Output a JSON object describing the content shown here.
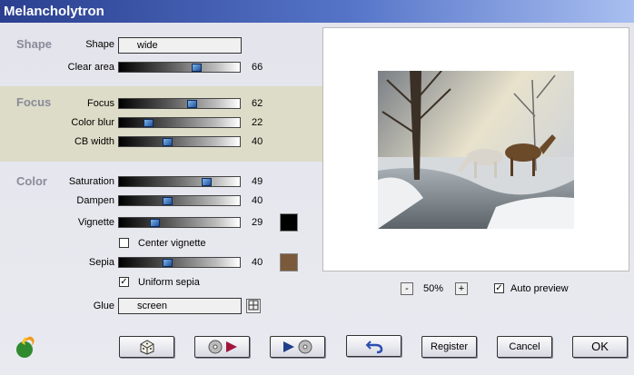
{
  "window": {
    "title": "Melancholytron"
  },
  "sections": {
    "shape": "Shape",
    "focus": "Focus",
    "color": "Color"
  },
  "shape": {
    "label": "Shape",
    "value": "wide"
  },
  "sliders": {
    "clear_area": {
      "label": "Clear area",
      "value": 66
    },
    "focus": {
      "label": "Focus",
      "value": 62
    },
    "color_blur": {
      "label": "Color blur",
      "value": 22
    },
    "cb_width": {
      "label": "CB width",
      "value": 40
    },
    "saturation": {
      "label": "Saturation",
      "value": 49
    },
    "dampen": {
      "label": "Dampen",
      "value": 40
    },
    "vignette": {
      "label": "Vignette",
      "value": 29,
      "color": "#000000"
    },
    "sepia": {
      "label": "Sepia",
      "value": 40,
      "color": "#7a5a3a"
    }
  },
  "checkboxes": {
    "center_vignette": {
      "label": "Center vignette",
      "checked": false
    },
    "uniform_sepia": {
      "label": "Uniform sepia",
      "checked": true
    },
    "auto_preview": {
      "label": "Auto preview",
      "checked": true
    }
  },
  "glue": {
    "label": "Glue",
    "value": "screen"
  },
  "zoom": {
    "minus": "-",
    "value": "50%",
    "plus": "+"
  },
  "buttons": {
    "random": "dice-icon",
    "load_preset": "disc-play-icon",
    "save_preset": "play-disc-icon",
    "undo": "undo-arrow-icon",
    "register": "Register",
    "cancel": "Cancel",
    "ok": "OK"
  },
  "colors": {
    "accent_title": "#2a3f8f",
    "section_text": "#8a8a9a",
    "band": "#dcdcc8"
  }
}
